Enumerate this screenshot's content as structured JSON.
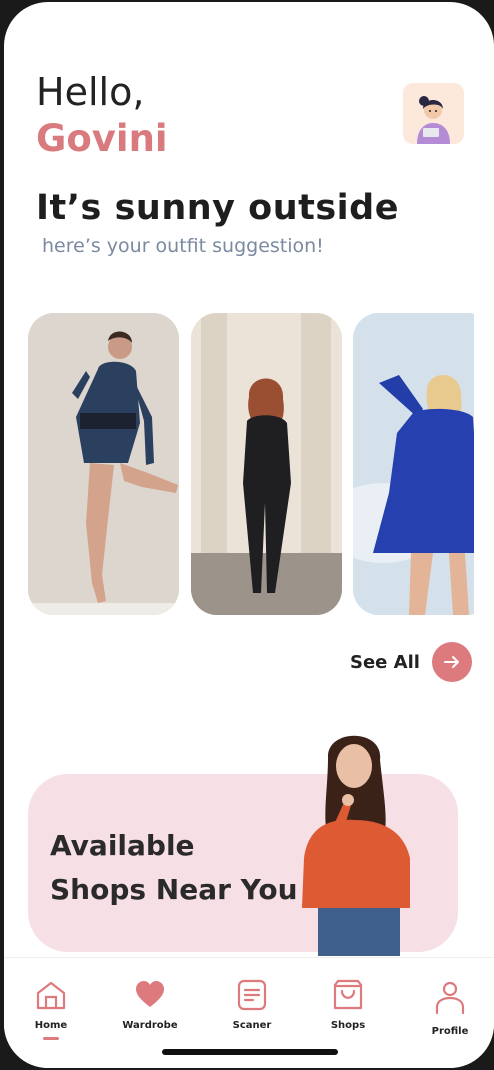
{
  "greeting": {
    "hello": "Hello,",
    "name": "Govini"
  },
  "weather": {
    "headline": "It’s sunny outside",
    "subline": "here’s your outfit suggestion!"
  },
  "outfits": {
    "cards": [
      {
        "icon": "woman-striped-dress-photo"
      },
      {
        "icon": "woman-black-jumpsuit-photo"
      },
      {
        "icon": "woman-blue-romper-photo"
      }
    ],
    "see_all_label": "See All"
  },
  "shops_banner": {
    "title": "Available Shops Near You"
  },
  "tabbar": {
    "items": [
      {
        "label": "Home",
        "icon": "home-icon",
        "active": true
      },
      {
        "label": "Wardrobe",
        "icon": "heart-icon"
      },
      {
        "label": "Scaner",
        "icon": "document-icon"
      },
      {
        "label": "Shops",
        "icon": "shopping-bag-icon"
      },
      {
        "label": "Profile",
        "icon": "user-icon"
      }
    ]
  },
  "colors": {
    "accent": "#dd7a7d",
    "name": "#d97a7e",
    "banner": "#f7dfe6",
    "subtext": "#7a8aa0"
  }
}
